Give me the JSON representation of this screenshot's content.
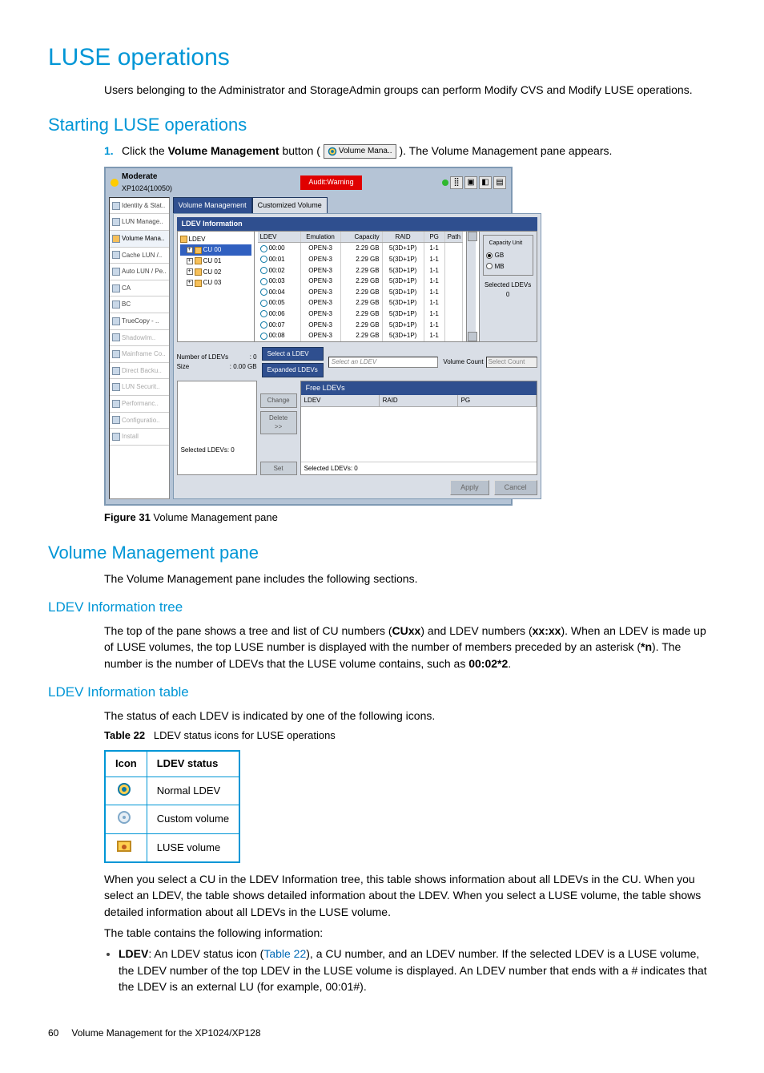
{
  "h1": "LUSE operations",
  "intro": "Users belonging to the Administrator and StorageAdmin groups can perform Modify CVS and Modify LUSE operations.",
  "h2_start": "Starting LUSE operations",
  "step1_pre": "Click the ",
  "step1_bold": "Volume Management",
  "step1_mid": " button (",
  "step1_btn_label": "Volume Mana..",
  "step1_post": "). The Volume Management pane appears.",
  "fig_label": "Figure 31",
  "fig_caption": "Volume Management pane",
  "h2_vmp": "Volume Management pane",
  "vmp_intro": "The Volume Management pane includes the following sections.",
  "h3_tree": "LDEV Information tree",
  "tree_p_a": "The top of the pane shows a tree and list of CU numbers (",
  "tree_p_b": "CUxx",
  "tree_p_c": ") and LDEV numbers (",
  "tree_p_d": "xx:xx",
  "tree_p_e": "). When an LDEV is made up of LUSE volumes, the top LUSE number is displayed with the number of members preceded by an asterisk (",
  "tree_p_f": "*n",
  "tree_p_g": "). The number is the number of LDEVs that the LUSE volume contains, such as ",
  "tree_p_h": "00:02*2",
  "tree_p_i": ".",
  "h3_table": "LDEV Information table",
  "table_intro": "The status of each LDEV is indicated by one of the following icons.",
  "tbl_label": "Table 22",
  "tbl_caption": "LDEV status icons for LUSE operations",
  "status_table": {
    "h_icon": "Icon",
    "h_status": "LDEV status",
    "rows": [
      {
        "name": "normal-ldev-icon",
        "status": "Normal LDEV"
      },
      {
        "name": "custom-volume-icon",
        "status": "Custom volume"
      },
      {
        "name": "luse-volume-icon",
        "status": "LUSE volume"
      }
    ]
  },
  "after_tbl_p1": "When you select a CU in the LDEV Information tree, this table shows information about all LDEVs in the CU. When you select an LDEV, the table shows detailed information about the LDEV. When you select a LUSE volume, the table shows detailed information about all LDEVs in the LUSE volume.",
  "after_tbl_p2": "The table contains the following information:",
  "bullet": {
    "b": "LDEV",
    "t1": ": An LDEV status icon (",
    "xref": "Table 22",
    "t2": "), a CU number, and an LDEV number. If the selected LDEV is a LUSE volume, the LDEV number of the top LDEV in the LUSE volume is displayed. An LDEV number that ends with a # indicates that the LDEV is an external LU (for example, 00:01#)."
  },
  "footer": {
    "page": "60",
    "text": "Volume Management for the XP1024/XP128"
  },
  "sshot": {
    "title1": "Moderate",
    "title2": "XP1024(10050)",
    "audit": "Audit:Warning",
    "side": [
      "Identity & Stat..",
      "LUN Manage..",
      "Volume Mana..",
      "Cache LUN /..",
      "Auto LUN / Pe..",
      "CA",
      "BC",
      "TrueCopy - ..",
      "ShadowIm..",
      "Mainframe Co..",
      "Direct Backu..",
      "LUN Securit..",
      "Performanc..",
      "Configuratio..",
      "Install"
    ],
    "side_active_index": 2,
    "tabs": {
      "active": "Volume Management",
      "inactive": "Customized Volume"
    },
    "panel_header": "LDEV Information",
    "tree_root": "LDEV",
    "tree_items": [
      "CU 00",
      "CU 01",
      "CU 02",
      "CU 03"
    ],
    "tree_selected_index": 0,
    "table": {
      "headers": {
        "ldev": "LDEV",
        "emu": "Emulation",
        "cap": "Capacity",
        "raid": "RAID",
        "pg": "PG",
        "path": "Path"
      },
      "rows": [
        {
          "ldev": "00:00",
          "emu": "OPEN-3",
          "cap": "2.29 GB",
          "raid": "5(3D+1P)",
          "pg": "1-1"
        },
        {
          "ldev": "00:01",
          "emu": "OPEN-3",
          "cap": "2.29 GB",
          "raid": "5(3D+1P)",
          "pg": "1-1"
        },
        {
          "ldev": "00:02",
          "emu": "OPEN-3",
          "cap": "2.29 GB",
          "raid": "5(3D+1P)",
          "pg": "1-1"
        },
        {
          "ldev": "00:03",
          "emu": "OPEN-3",
          "cap": "2.29 GB",
          "raid": "5(3D+1P)",
          "pg": "1-1"
        },
        {
          "ldev": "00:04",
          "emu": "OPEN-3",
          "cap": "2.29 GB",
          "raid": "5(3D+1P)",
          "pg": "1-1"
        },
        {
          "ldev": "00:05",
          "emu": "OPEN-3",
          "cap": "2.29 GB",
          "raid": "5(3D+1P)",
          "pg": "1-1"
        },
        {
          "ldev": "00:06",
          "emu": "OPEN-3",
          "cap": "2.29 GB",
          "raid": "5(3D+1P)",
          "pg": "1-1"
        },
        {
          "ldev": "00:07",
          "emu": "OPEN-3",
          "cap": "2.29 GB",
          "raid": "5(3D+1P)",
          "pg": "1-1"
        },
        {
          "ldev": "00:08",
          "emu": "OPEN-3",
          "cap": "2.29 GB",
          "raid": "5(3D+1P)",
          "pg": "1-1"
        }
      ]
    },
    "cu": {
      "legend": "Capacity Unit",
      "opt_gb": "GB",
      "opt_mb": "MB",
      "sel_label": "Selected LDEVs",
      "sel_val": "0"
    },
    "mid": {
      "num_label": "Number of LDEVs",
      "num_val": ": 0",
      "size_label": "Size",
      "size_val": ": 0.00 GB",
      "btn_select": "Select a LDEV",
      "ph_select": "Select an LDEV",
      "btn_expanded": "Expanded LDEVs",
      "volcount_label": "Volume Count",
      "volcount_ph": "Select Count"
    },
    "lower": {
      "free_header": "Free LDEVs",
      "cols": {
        "ldev": "LDEV",
        "raid": "RAID",
        "pg": "PG"
      },
      "btn_change": "Change",
      "btn_delete": "Delete >>",
      "btn_set": "Set",
      "foot_left": "Selected LDEVs: 0",
      "foot_right": "Selected LDEVs: 0"
    },
    "footer_btns": {
      "apply": "Apply",
      "cancel": "Cancel"
    }
  }
}
